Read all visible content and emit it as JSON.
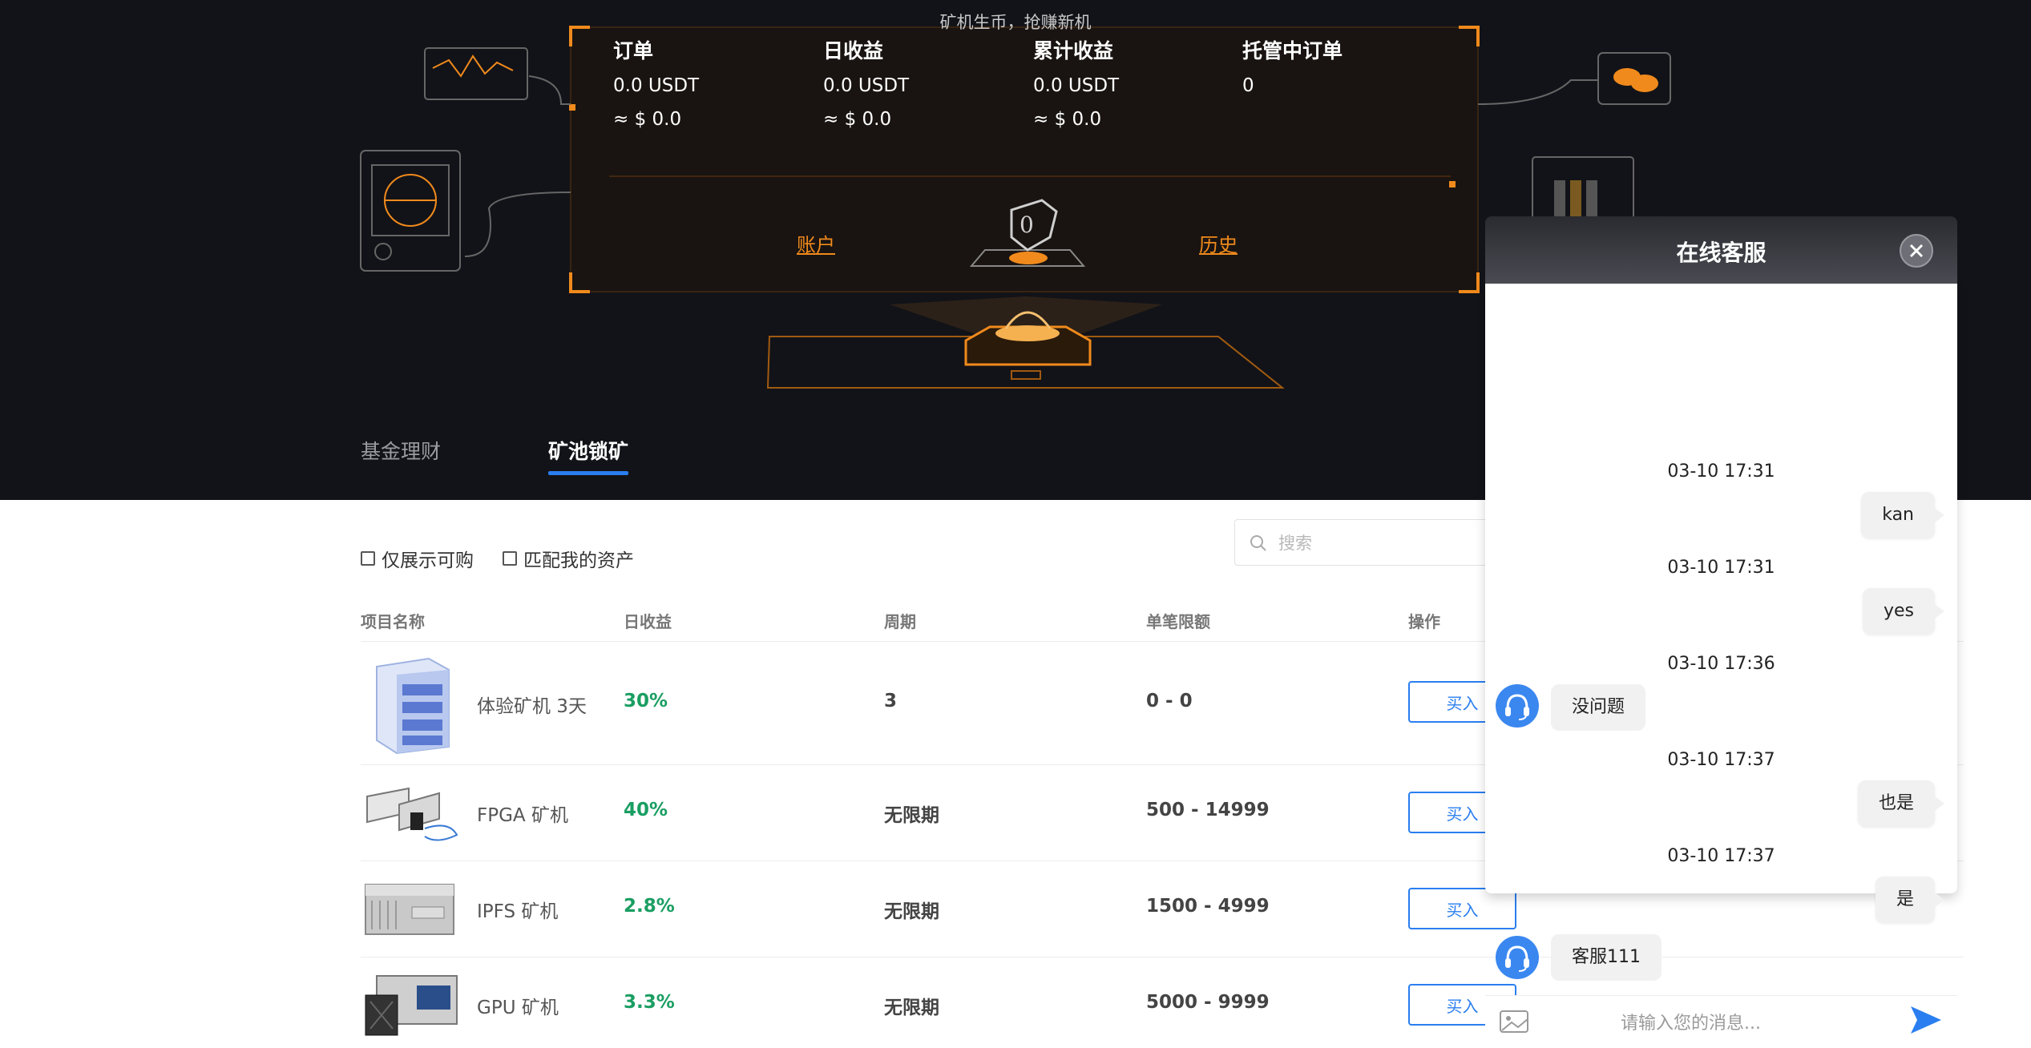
{
  "hero": {
    "slogan": "矿机生币，抢赚新机",
    "stats": [
      {
        "label": "订单",
        "value": "0.0 USDT",
        "approx": "≈ $ 0.0"
      },
      {
        "label": "日收益",
        "value": "0.0 USDT",
        "approx": "≈ $ 0.0"
      },
      {
        "label": "累计收益",
        "value": "0.0 USDT",
        "approx": "≈ $ 0.0"
      },
      {
        "label": "托管中订单",
        "value": "0",
        "approx": ""
      }
    ],
    "account_link": "账户",
    "history_link": "历史"
  },
  "tabs": [
    {
      "label": "基金理财"
    },
    {
      "label": "矿池锁矿"
    }
  ],
  "filters": {
    "only_available": "仅展示可购",
    "match_assets": "匹配我的资产",
    "search_placeholder": "搜索"
  },
  "table": {
    "headers": [
      "项目名称",
      "日收益",
      "周期",
      "单笔限额",
      "操作"
    ],
    "rows": [
      {
        "name": "体验矿机 3天",
        "rate": "30%",
        "period": "3",
        "limit": "0 - 0",
        "action": "买入"
      },
      {
        "name": "FPGA 矿机",
        "rate": "40%",
        "period": "无限期",
        "limit": "500 - 14999",
        "action": "买入"
      },
      {
        "name": "IPFS 矿机",
        "rate": "2.8%",
        "period": "无限期",
        "limit": "1500 - 4999",
        "action": "买入"
      },
      {
        "name": "GPU 矿机",
        "rate": "3.3%",
        "period": "无限期",
        "limit": "5000 - 9999",
        "action": "买入"
      }
    ]
  },
  "chat": {
    "title": "在线客服",
    "messages": [
      {
        "time": "03-10 17:31",
        "side": "right",
        "text": "kan"
      },
      {
        "time": "03-10 17:31",
        "side": "right",
        "text": "yes"
      },
      {
        "time": "03-10 17:36",
        "side": "left",
        "text": "没问题"
      },
      {
        "time": "03-10 17:37",
        "side": "right",
        "text": "也是"
      },
      {
        "time": "03-10 17:37",
        "side": "right",
        "text": "是"
      },
      {
        "time": "",
        "side": "left",
        "text": "客服111"
      }
    ],
    "input_placeholder": "请输入您的消息..."
  },
  "colors": {
    "accent_orange": "#f08a1c",
    "accent_blue": "#2a7ef0",
    "profit_green": "#1a9e62",
    "hero_bg": "#121318"
  }
}
